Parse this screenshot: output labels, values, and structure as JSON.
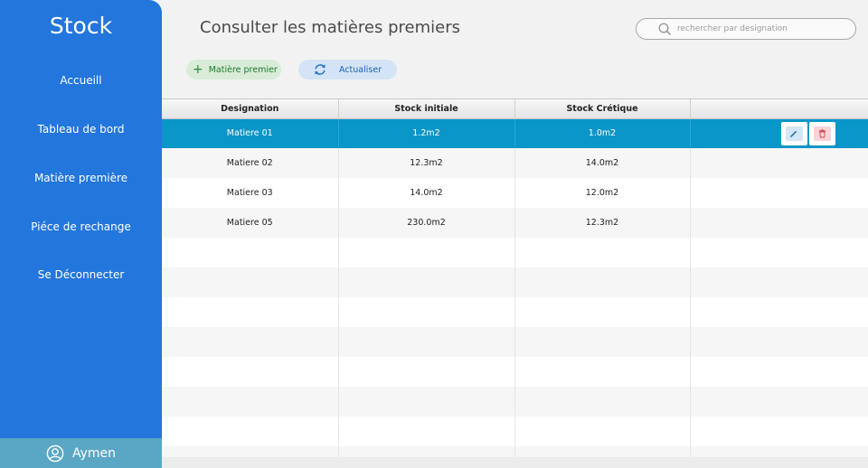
{
  "sidebar": {
    "brand": "Stock",
    "items": [
      {
        "label": "Accueill"
      },
      {
        "label": "Tableau de bord"
      },
      {
        "label": "Matière première"
      },
      {
        "label": "Piéce de rechange"
      },
      {
        "label": "Se Déconnecter"
      }
    ],
    "user": {
      "name": "Aymen",
      "icon": "user-circle-icon"
    }
  },
  "header": {
    "title": "Consulter les matières premiers",
    "search": {
      "placeholder": "rechercher par designation",
      "value": "",
      "icon": "search-icon"
    }
  },
  "toolbar": {
    "add_label": "Matière premier",
    "add_icon": "plus-icon",
    "refresh_label": "Actualiser",
    "refresh_icon": "refresh-icon"
  },
  "table": {
    "columns": [
      "Designation",
      "Stock initiale",
      "Stock Crétique",
      ""
    ],
    "rows": [
      {
        "designation": "Matiere 01",
        "stock_initiale": "1.2m2",
        "stock_critique": "1.0m2",
        "selected": true
      },
      {
        "designation": "Matiere 02",
        "stock_initiale": "12.3m2",
        "stock_critique": "14.0m2",
        "selected": false
      },
      {
        "designation": "Matiere 03",
        "stock_initiale": "14.0m2",
        "stock_critique": "12.0m2",
        "selected": false
      },
      {
        "designation": "Matiere 05",
        "stock_initiale": "230.0m2",
        "stock_critique": "12.3m2",
        "selected": false
      }
    ],
    "row_actions": [
      {
        "icon": "pencil-icon"
      },
      {
        "icon": "trash-icon"
      }
    ]
  },
  "colors": {
    "sidebar_bg": "#2376dc",
    "selected_row": "#0a96c8",
    "user_bar": "#5aa7c5",
    "add_button_bg": "#d8ecd8",
    "refresh_button_bg": "#d4e4f6"
  }
}
